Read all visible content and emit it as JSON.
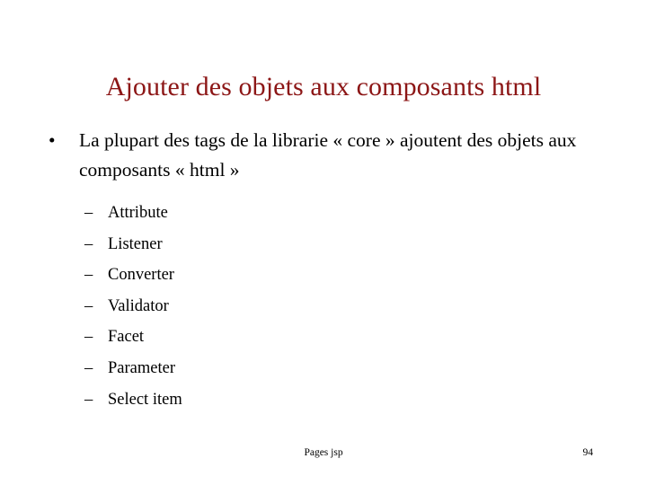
{
  "slide": {
    "title": "Ajouter des objets aux composants html",
    "title_color": "#8c1616",
    "body_color": "#000000",
    "background_color": "#ffffff",
    "bullets": [
      {
        "marker": "•",
        "text": "La plupart des tags de la librarie « core » ajoutent des objets aux composants « html »"
      }
    ],
    "sub_bullets": [
      {
        "marker": "–",
        "text": "Attribute"
      },
      {
        "marker": "–",
        "text": "Listener"
      },
      {
        "marker": "–",
        "text": "Converter"
      },
      {
        "marker": "–",
        "text": "Validator"
      },
      {
        "marker": "–",
        "text": "Facet"
      },
      {
        "marker": "–",
        "text": "Parameter"
      },
      {
        "marker": "–",
        "text": "Select item"
      }
    ],
    "footer": {
      "center_text": "Pages jsp",
      "page_number": "94"
    }
  }
}
